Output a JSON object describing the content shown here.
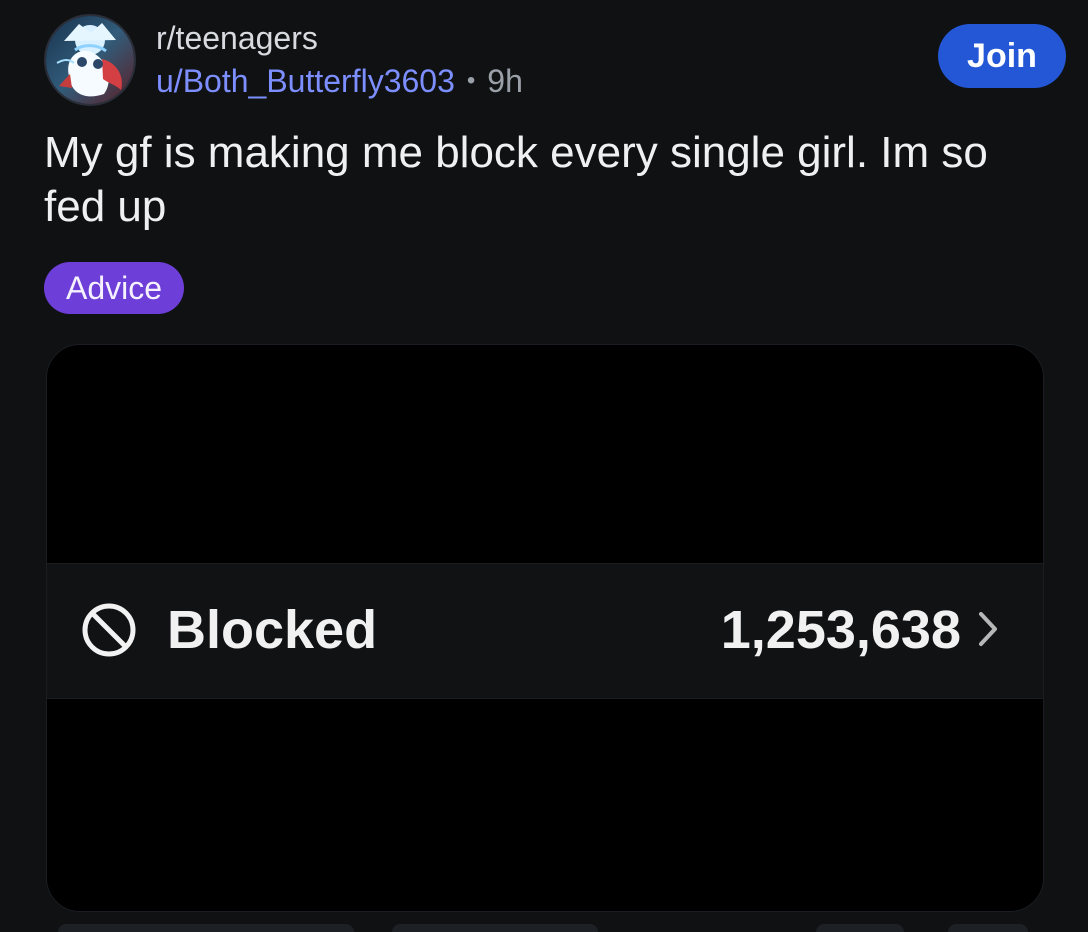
{
  "post": {
    "subreddit": "r/teenagers",
    "username": "u/Both_Butterfly3603",
    "separator": "•",
    "time": "9h",
    "join_label": "Join",
    "title": "My gf is making me block every single girl. Im so fed up",
    "flair": "Advice"
  },
  "media": {
    "blocked_label": "Blocked",
    "blocked_count": "1,253,638",
    "chevron": "›"
  },
  "icons": {
    "avatar": "avatar-illustration",
    "blocked": "block-icon",
    "chevron": "chevron-right-icon"
  },
  "colors": {
    "background": "#0f1113",
    "username": "#7d8eff",
    "join_button": "#2457d6",
    "flair": "#6e3fd8",
    "media_background": "#000000"
  }
}
